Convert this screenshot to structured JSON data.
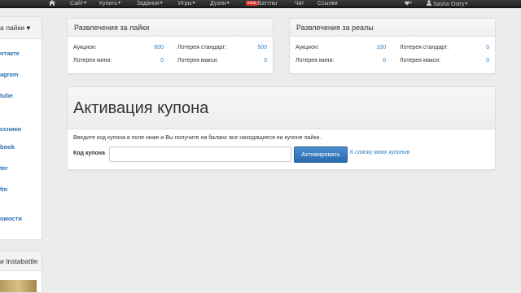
{
  "navbar": {
    "items": [
      {
        "label": "Сайт",
        "has_caret": true
      },
      {
        "label": "Купить",
        "has_caret": true
      },
      {
        "label": "Задания",
        "has_caret": true
      },
      {
        "label": "Игры",
        "has_caret": true
      },
      {
        "label": "Дуэли",
        "has_caret": true
      },
      {
        "badge": "insta",
        "label": "Баттлы"
      },
      {
        "label": "Чат"
      },
      {
        "label": "Ссылки"
      }
    ],
    "likes_count": "0",
    "user_name": "Sasha Ostry",
    "home_icon": "home-icon",
    "user_icon": "user-icon",
    "like_icon": "heart-icon"
  },
  "sidebar": {
    "title": "а лайки ♥",
    "links": [
      "нтакте",
      "agram",
      "tube",
      "ссники",
      "book",
      "ter",
      "fm",
      "",
      "омости"
    ],
    "section2_title": "и Instabattle"
  },
  "panel_likes": {
    "title": "Развлечения за лайки",
    "rows": [
      {
        "label1": "Аукцион:",
        "val1": "600",
        "label2": "Лотерея стандарт:",
        "val2": "500"
      },
      {
        "label1": "Лотерея мини:",
        "val1": "0",
        "label2": "Лотерея макси:",
        "val2": "0"
      }
    ]
  },
  "panel_reals": {
    "title": "Развлечения за реалы",
    "rows": [
      {
        "label1": "Аукцион:",
        "val1": "100",
        "label2": "Лотерея стандарт:",
        "val2": "0"
      },
      {
        "label1": "Лотерея мини:",
        "val1": "0",
        "label2": "Лотерея макси:",
        "val2": "0"
      }
    ]
  },
  "coupon": {
    "title": "Активация купона",
    "description": "Введите код купона в поле ниже и Вы получите на баланс все находящиеся на купоне лайки.",
    "field_label": "Код купона",
    "input_value": "",
    "input_placeholder": "",
    "button_label": "Активировать",
    "link_label": "К списку моих купонов"
  },
  "colors": {
    "navbar_bg": "#262626",
    "link": "#2a7fc4",
    "button": "#3a7cc0",
    "badge": "#e0322a"
  }
}
